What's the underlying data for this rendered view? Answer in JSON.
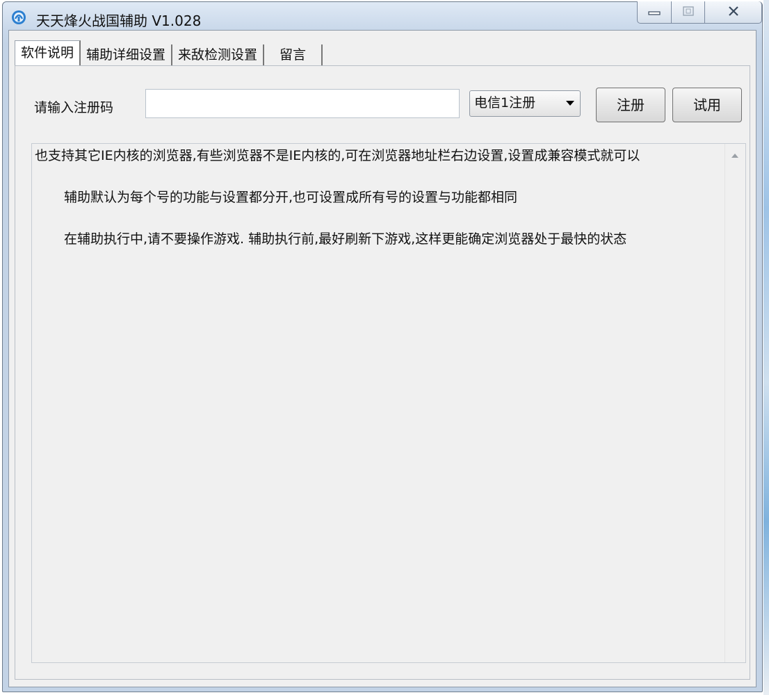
{
  "window": {
    "title": "天天烽火战国辅助 V1.028",
    "accent": "#c3d3e6"
  },
  "icons": {
    "app": "app-logo-icon",
    "minimize": "minimize-icon",
    "maximize": "maximize-icon",
    "close": "close-icon",
    "dropdown": "chevron-down-icon",
    "scroll_up": "scroll-up-arrow-icon"
  },
  "tabs": [
    {
      "label": "软件说明",
      "active": true
    },
    {
      "label": "辅助详细设置",
      "active": false
    },
    {
      "label": "来敌检测设置",
      "active": false
    },
    {
      "label": "留言",
      "active": false
    }
  ],
  "registration": {
    "label": "请输入注册码",
    "code_value": "",
    "carrier_selected": "电信1注册",
    "register_button": "注册",
    "trial_button": "试用"
  },
  "description": {
    "line1": "也支持其它IE内核的浏览器,有些浏览器不是IE内核的,可在浏览器地址栏右边设置,设置成兼容模式就可以",
    "line2": "辅助默认为每个号的功能与设置都分开,也可设置成所有号的设置与功能都相同",
    "line3": "在辅助执行中,请不要操作游戏.  辅助执行前,最好刷新下游戏,这样更能确定浏览器处于最快的状态"
  }
}
